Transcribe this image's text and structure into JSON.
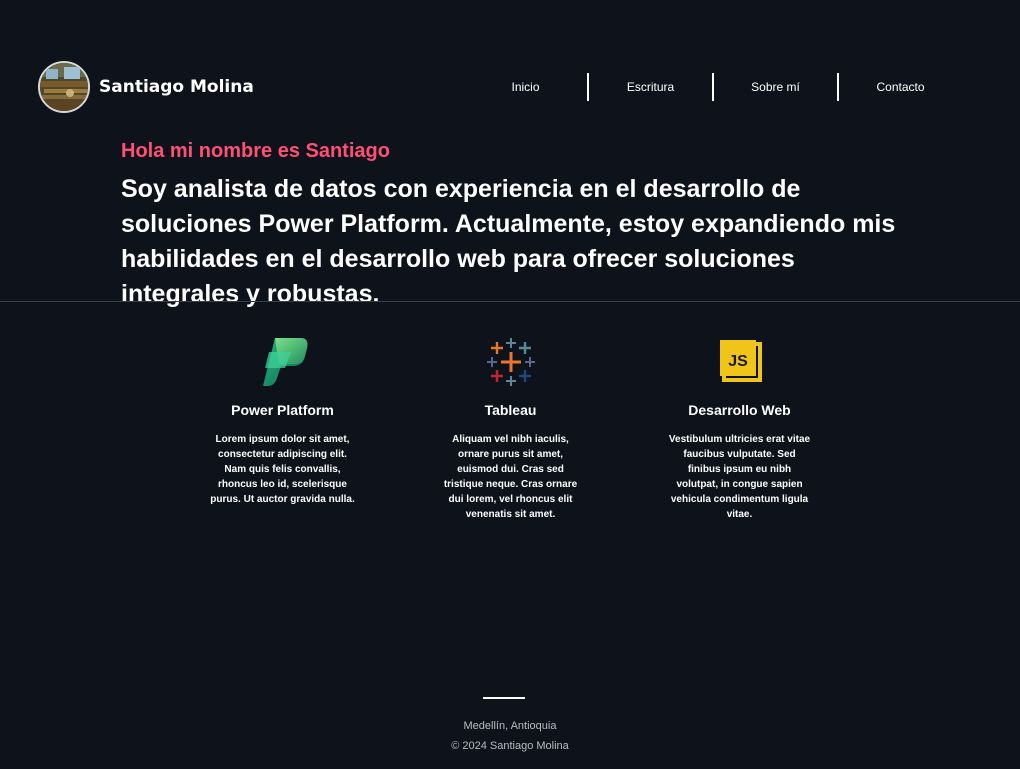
{
  "brand": {
    "name": "Santiago Molina"
  },
  "nav": {
    "items": [
      {
        "label": "Inicio"
      },
      {
        "label": "Escritura"
      },
      {
        "label": "Sobre mí"
      },
      {
        "label": "Contacto"
      }
    ]
  },
  "hero": {
    "greeting": "Hola mi nombre es Santiago",
    "text": "Soy analista de datos con experiencia en el desarrollo de soluciones Power Platform. Actualmente, estoy expandiendo mis habilidades en el desarrollo web para ofrecer soluciones integrales y robustas."
  },
  "skills": [
    {
      "icon": "power-platform-icon",
      "title": "Power Platform",
      "desc": "Lorem ipsum dolor sit amet, consectetur adipiscing elit. Nam quis felis convallis, rhoncus leo id, scelerisque purus. Ut auctor gravida nulla."
    },
    {
      "icon": "tableau-icon",
      "title": "Tableau",
      "desc": "Aliquam vel nibh iaculis, ornare purus sit amet, euismod dui. Cras sed tristique neque. Cras ornare dui lorem, vel rhoncus elit venenatis sit amet."
    },
    {
      "icon": "javascript-icon",
      "title": "Desarrollo Web",
      "desc": "Vestibulum ultricies erat vitae faucibus vulputate. Sed finibus ipsum eu nibh volutpat, in congue sapien vehicula condimentum ligula vitae."
    }
  ],
  "footer": {
    "location": "Medellín, Antioquia",
    "copyright": "© 2024 Santiago Molina"
  },
  "colors": {
    "background": "#0e131b",
    "accent": "#ff4f74",
    "text": "#ffffff",
    "muted": "#b8bcc2"
  }
}
